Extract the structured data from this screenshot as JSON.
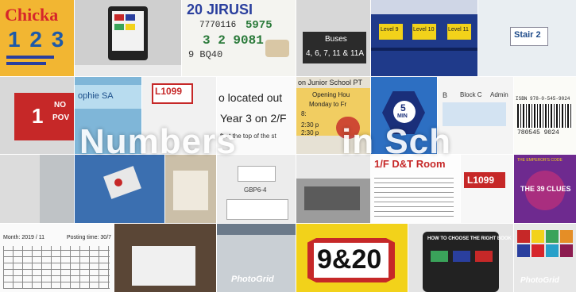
{
  "collage": {
    "overlay_left": "Numbers",
    "overlay_right": "in Sch",
    "photo_grid_watermark": "PhotoGrid"
  },
  "tiles": {
    "book_chicka": {
      "title": "Chicka",
      "numbers": "1 2 3"
    },
    "receipt": {
      "logo": "20 JIRUSI",
      "line1": "7770116",
      "line2": "3 2 9081",
      "line3": "9 BQ40",
      "handwritten": "5975"
    },
    "buses": {
      "header": "Buses",
      "routes": "4, 6, 7, 11 & 11A"
    },
    "levels": {
      "level_left": "Level 9",
      "level_mid": "Level 10",
      "level_right": "Level 11"
    },
    "stair": {
      "label": "Stair 2"
    },
    "red_sign": {
      "number": "1",
      "text1": "NO",
      "text2": "POV"
    },
    "sophie": {
      "label": "ophie SA"
    },
    "room_tag": {
      "label": "L1099"
    },
    "located": {
      "line1": "o located out",
      "line2": "Year 3 on 2/F",
      "line3": "ft at the top of the st"
    },
    "school": {
      "line1": "on Junior School PT",
      "line2": "Opening Hou",
      "line3": "Monday to Fr",
      "line4": "8:",
      "line5": "2:30 p",
      "line6": "2:30 p"
    },
    "hexagon": {
      "number": "5",
      "unit": "MIN"
    },
    "block": {
      "label_b": "B",
      "label_block": "Block C",
      "label_admin": "Admin"
    },
    "barcode": {
      "isbn": "ISBN 978-0-545-9024",
      "digits": "780545 9024"
    },
    "socket": {
      "label": "GBP6-4"
    },
    "dt_room": {
      "label": "1/F D&T Room"
    },
    "room_tag2": {
      "label": "L1099"
    },
    "clues": {
      "publisher": "THE EMPEROR'S CODE",
      "title": "THE 39 CLUES"
    },
    "chart": {
      "month": "Month: 2019 / 11",
      "posting": "Posting time: 30/7"
    },
    "poster_920": {
      "text": "9&20"
    },
    "choose_book": {
      "title": "HOW TO CHOOSE THE RIGHT BOOK"
    },
    "colors": {
      "accent_red": "#c62828",
      "accent_yellow": "#f2d21a",
      "accent_blue": "#2a3f9e",
      "accent_green": "#3aa35a"
    }
  }
}
